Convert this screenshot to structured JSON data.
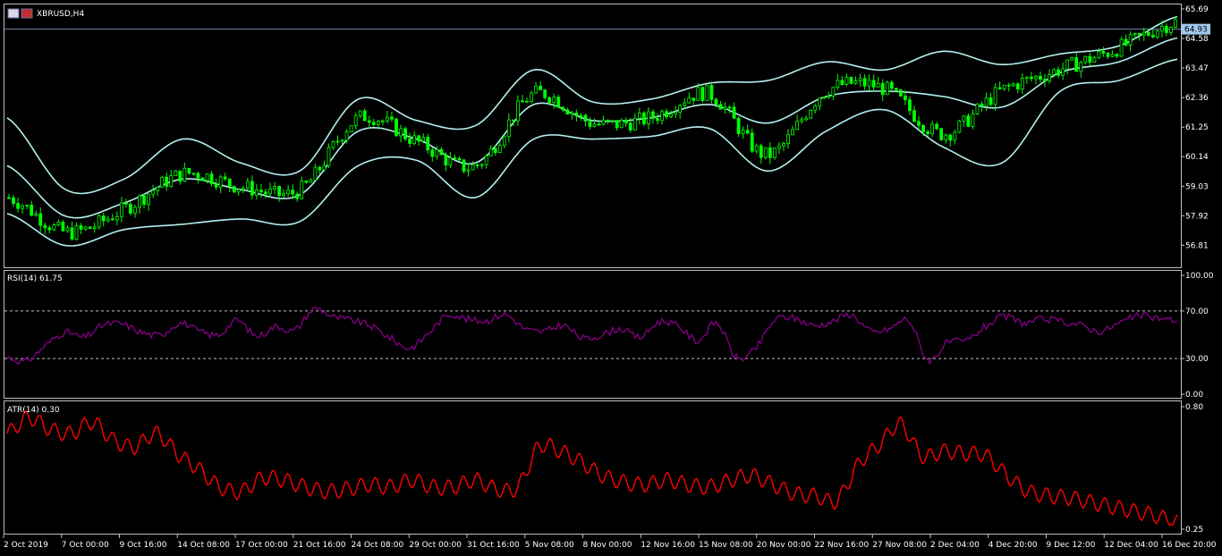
{
  "main": {
    "symbol_label": "XBRUSD,H4",
    "current_price_label": "64.93",
    "current_price": 64.93,
    "y_axis_ticks": [
      "65.69",
      "64.58",
      "63.47",
      "62.36",
      "61.25",
      "60.14",
      "59.03",
      "57.92",
      "56.81"
    ],
    "ylim": [
      55.95,
      65.69
    ]
  },
  "rsi": {
    "title": "RSI(14) 61.75",
    "y_axis_ticks": [
      "100.00",
      "70.00",
      "30.00",
      "0.00"
    ],
    "levels": [
      70,
      30
    ],
    "ylim": [
      0,
      100
    ]
  },
  "atr": {
    "title": "ATR(14) 0.30",
    "y_axis_ticks": [
      "0.80",
      "0.25"
    ],
    "ylim": [
      0.25,
      0.8
    ]
  },
  "x_axis_labels": [
    "2 Oct 2019",
    "7 Oct 00:00",
    "9 Oct 16:00",
    "14 Oct 08:00",
    "17 Oct 00:00",
    "21 Oct 16:00",
    "24 Oct 08:00",
    "29 Oct 00:00",
    "31 Oct 16:00",
    "5 Nov 08:00",
    "8 Nov 00:00",
    "12 Nov 16:00",
    "15 Nov 08:00",
    "20 Nov 00:00",
    "22 Nov 16:00",
    "27 Nov 08:00",
    "2 Dec 04:00",
    "4 Dec 20:00",
    "9 Dec 12:00",
    "12 Dec 04:00",
    "16 Dec 20:00"
  ],
  "colors": {
    "background": "#000000",
    "grid_border": "#c0c0c0",
    "candle": "#00ff00",
    "bands": "#b4f0f0",
    "rsi_line": "#800080",
    "atr_line": "#ff0000",
    "price_marker": "#a0c8f0"
  },
  "chart_data": [
    {
      "type": "line",
      "description_series": "Bollinger Bands around XBRUSD H4 price (approximate readings)",
      "x": [
        "2 Oct 2019",
        "7 Oct 00:00",
        "9 Oct 16:00",
        "14 Oct 08:00",
        "17 Oct 00:00",
        "21 Oct 16:00",
        "24 Oct 08:00",
        "29 Oct 00:00",
        "31 Oct 16:00",
        "5 Nov 08:00",
        "8 Nov 00:00",
        "12 Nov 16:00",
        "15 Nov 08:00",
        "20 Nov 00:00",
        "22 Nov 16:00",
        "27 Nov 08:00",
        "2 Dec 04:00",
        "4 Dec 20:00",
        "9 Dec 12:00",
        "12 Dec 04:00",
        "16 Dec 20:00"
      ],
      "series": [
        {
          "name": "upper",
          "values": [
            61.6,
            58.9,
            59.3,
            60.8,
            59.9,
            59.6,
            62.3,
            61.5,
            61.3,
            63.4,
            62.2,
            62.3,
            62.9,
            63.0,
            63.7,
            63.4,
            64.1,
            63.6,
            64.0,
            64.3,
            65.4
          ]
        },
        {
          "name": "middle",
          "values": [
            59.8,
            57.9,
            58.4,
            59.3,
            58.9,
            58.7,
            61.1,
            60.8,
            59.9,
            62.1,
            61.5,
            61.6,
            62.1,
            61.4,
            62.4,
            62.6,
            62.4,
            62.0,
            63.3,
            63.7,
            64.6
          ]
        },
        {
          "name": "lower",
          "values": [
            58.0,
            56.8,
            57.4,
            57.6,
            57.8,
            57.7,
            59.8,
            60.0,
            58.6,
            60.8,
            60.8,
            60.9,
            61.2,
            59.6,
            61.1,
            61.9,
            60.5,
            59.9,
            62.6,
            63.0,
            63.8
          ]
        }
      ],
      "candle_closes": [
        58.6,
        57.3,
        58.2,
        59.5,
        59.0,
        58.9,
        61.6,
        60.7,
        59.8,
        62.5,
        61.4,
        61.6,
        62.5,
        60.2,
        62.6,
        62.7,
        61.0,
        62.6,
        63.4,
        64.2,
        65.2
      ],
      "ylim": [
        55.95,
        65.69
      ]
    },
    {
      "type": "line",
      "series": [
        {
          "name": "RSI(14)",
          "values": [
            31,
            28,
            41,
            52,
            48,
            58,
            59,
            52,
            50,
            60,
            53,
            50,
            62,
            49,
            57,
            54,
            72,
            65,
            62,
            57,
            47,
            39,
            52,
            67,
            63,
            62,
            67,
            55,
            53,
            58,
            47,
            50,
            55,
            48,
            61,
            57,
            45,
            60,
            31,
            38,
            62,
            64,
            58,
            61,
            67,
            53,
            55,
            62,
            29,
            43,
            45,
            57,
            65,
            60,
            63,
            61,
            58,
            53,
            60,
            66,
            64,
            62
          ]
        }
      ],
      "levels": [
        70,
        30
      ],
      "ylim": [
        0,
        100
      ]
    },
    {
      "type": "line",
      "series": [
        {
          "name": "ATR(14)",
          "values": [
            0.68,
            0.75,
            0.7,
            0.68,
            0.73,
            0.65,
            0.62,
            0.68,
            0.59,
            0.52,
            0.44,
            0.42,
            0.48,
            0.47,
            0.44,
            0.42,
            0.43,
            0.45,
            0.44,
            0.47,
            0.44,
            0.44,
            0.47,
            0.43,
            0.44,
            0.62,
            0.6,
            0.55,
            0.49,
            0.46,
            0.45,
            0.47,
            0.45,
            0.44,
            0.47,
            0.49,
            0.45,
            0.41,
            0.4,
            0.38,
            0.54,
            0.63,
            0.72,
            0.58,
            0.6,
            0.59,
            0.58,
            0.49,
            0.42,
            0.4,
            0.39,
            0.37,
            0.35,
            0.33,
            0.31,
            0.28
          ]
        }
      ],
      "ylim": [
        0.25,
        0.8
      ]
    }
  ]
}
